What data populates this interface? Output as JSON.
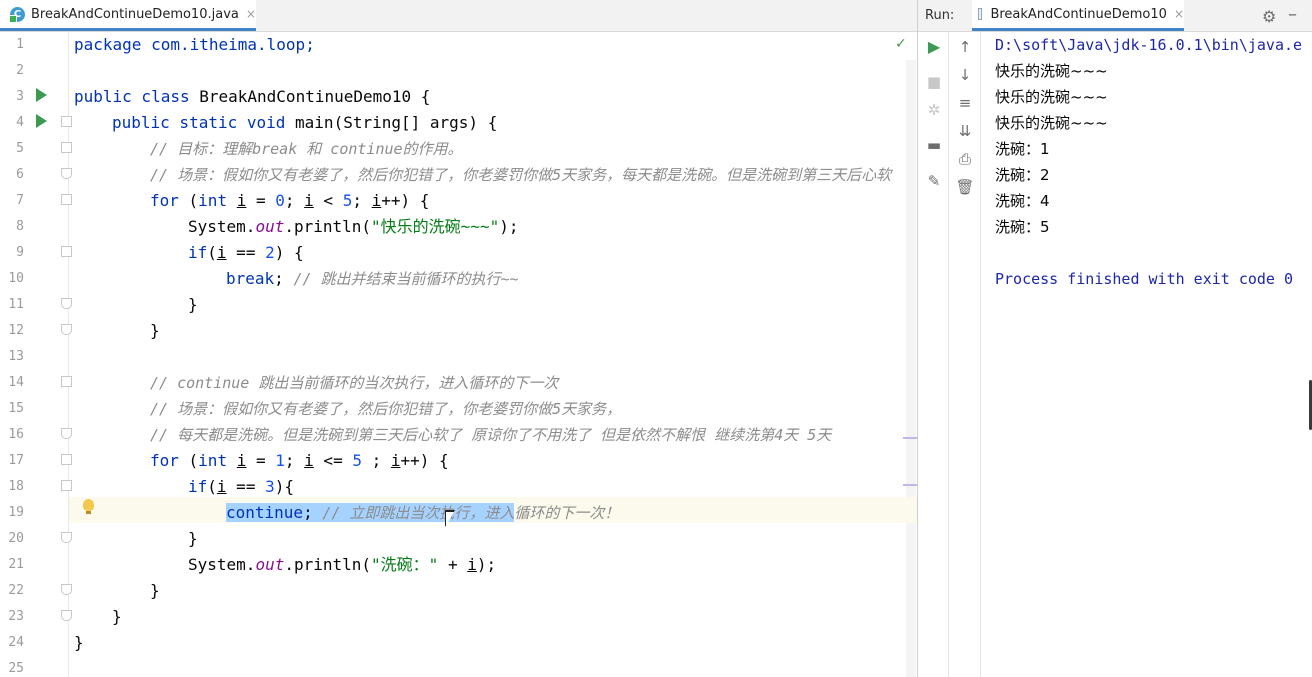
{
  "editor": {
    "tab": {
      "icon": "java-class-icon",
      "label": "BreakAndContinueDemo10.java",
      "close": "×"
    },
    "line_numbers": [
      "1",
      "2",
      "3",
      "4",
      "5",
      "6",
      "7",
      "8",
      "9",
      "10",
      "11",
      "12",
      "13",
      "14",
      "15",
      "16",
      "17",
      "18",
      "19",
      "20",
      "21",
      "22",
      "23",
      "24",
      "25"
    ],
    "lines": {
      "l1": {
        "a": "package com.itheima.loop;"
      },
      "l3": {
        "a": "public class ",
        "b": "BreakAndContinueDemo10 {"
      },
      "l4": {
        "a": "public static void ",
        "b": "main(String[] args) {"
      },
      "l5": {
        "a": "// 目标：理解break 和 continue的作用。"
      },
      "l6": {
        "a": "// 场景：假如你又有老婆了，然后你犯错了，你老婆罚你做5天家务，每天都是洗碗。但是洗碗到第三天后心软"
      },
      "l7": {
        "a": "for",
        "b": " (",
        "c": "int ",
        "d": "i",
        "e": " = ",
        "f": "0",
        "g": "; ",
        "h": "i",
        "i": " < ",
        "j": "5",
        "k": "; ",
        "l": "i",
        "m": "++) {"
      },
      "l8": {
        "a": "System.",
        "b": "out",
        "c": ".println(",
        "d": "\"快乐的洗碗~~~\"",
        "e": ");"
      },
      "l9": {
        "a": "if",
        "b": "(",
        "c": "i",
        "d": " == ",
        "e": "2",
        "f": ") {"
      },
      "l10": {
        "a": "break",
        "b": "; ",
        "c": "// 跳出并结束当前循环的执行~~"
      },
      "l11": {
        "a": "}"
      },
      "l12": {
        "a": "}"
      },
      "l14": {
        "a": "// continue 跳出当前循环的当次执行，进入循环的下一次"
      },
      "l15": {
        "a": "// 场景：假如你又有老婆了，然后你犯错了，你老婆罚你做5天家务，"
      },
      "l16": {
        "a": "// 每天都是洗碗。但是洗碗到第三天后心软了 原谅你了不用洗了 但是依然不解恨 继续洗第4天 5天"
      },
      "l17": {
        "a": "for",
        "b": " (",
        "c": "int ",
        "d": "i",
        "e": " = ",
        "f": "1",
        "g": "; ",
        "h": "i",
        "i": " <= ",
        "j": "5",
        "k": " ; ",
        "l": "i",
        "m": "++) {"
      },
      "l18": {
        "a": "if",
        "b": "(",
        "c": "i",
        "d": " == ",
        "e": "3",
        "f": "){"
      },
      "l19": {
        "a": "continue",
        "b": "; ",
        "c": "// 立即跳出当次执行，进入",
        "d": "循环的下一次！"
      },
      "l20": {
        "a": "}"
      },
      "l21": {
        "a": "System.",
        "b": "out",
        "c": ".println(",
        "d": "\"洗碗：\"",
        "e": " + ",
        "f": "i",
        "g": ");"
      },
      "l22": {
        "a": "}"
      },
      "l23": {
        "a": "}"
      },
      "l24": {
        "a": "}"
      }
    }
  },
  "run_panel": {
    "label": "Run:",
    "tab": {
      "label": "BreakAndContinueDemo10",
      "close": "×"
    },
    "console_lines": [
      "D:\\soft\\Java\\jdk-16.0.1\\bin\\java.e",
      "快乐的洗碗~~~",
      "快乐的洗碗~~~",
      "快乐的洗碗~~~",
      "洗碗：1",
      "洗碗：2",
      "洗碗：4",
      "洗碗：5",
      "",
      "Process finished with exit code 0"
    ]
  },
  "colors": {
    "keyword": "#0033b3",
    "comment": "#8c8c8c",
    "string": "#067d17",
    "number": "#1750eb",
    "selection": "#a6d2ff",
    "accent": "#4083c9"
  }
}
